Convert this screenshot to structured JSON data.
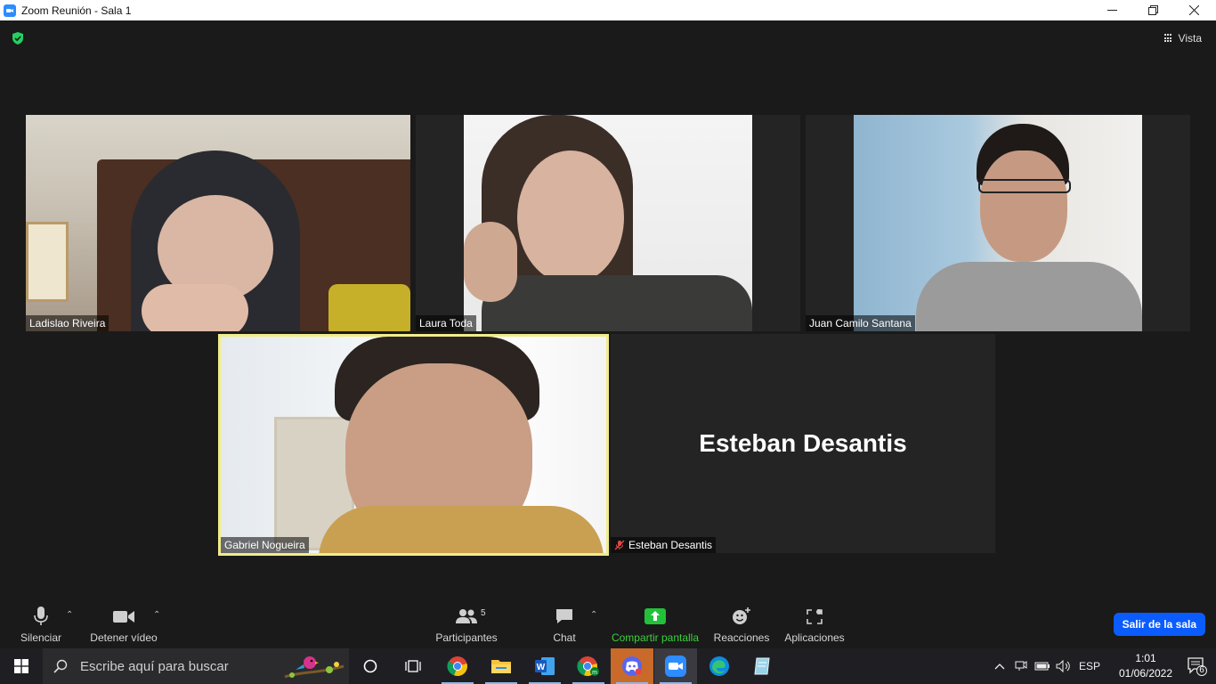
{
  "window": {
    "title": "Zoom Reunión - Sala 1"
  },
  "meeting": {
    "view_label": "Vista",
    "participants": [
      {
        "name": "Ladislao Riveira"
      },
      {
        "name": "Laura Toda"
      },
      {
        "name": "Juan Camilo Santana"
      },
      {
        "name": "Gabriel Nogueira",
        "active_speaker": true
      },
      {
        "name": "Esteban Desantis",
        "video_off": true,
        "muted": true
      }
    ],
    "video_off_display_name": "Esteban Desantis"
  },
  "toolbar": {
    "mute_label": "Silenciar",
    "video_label": "Detener vídeo",
    "participants_label": "Participantes",
    "participants_count": "5",
    "chat_label": "Chat",
    "share_label": "Compartir pantalla",
    "reactions_label": "Reacciones",
    "apps_label": "Aplicaciones",
    "leave_label": "Salir de la sala",
    "share_color": "#3ad13a",
    "leave_color": "#0b5cff"
  },
  "taskbar": {
    "search_placeholder": "Escribe aquí para buscar",
    "apps": [
      "cortana-icon",
      "task-view-icon",
      "chrome-icon",
      "file-explorer-icon",
      "word-icon",
      "chrome-meet-icon",
      "discord-icon",
      "zoom-icon",
      "edge-icon",
      "notes-icon"
    ],
    "language": "ESP",
    "time": "1:01",
    "date": "01/06/2022",
    "notification_count": "6"
  }
}
